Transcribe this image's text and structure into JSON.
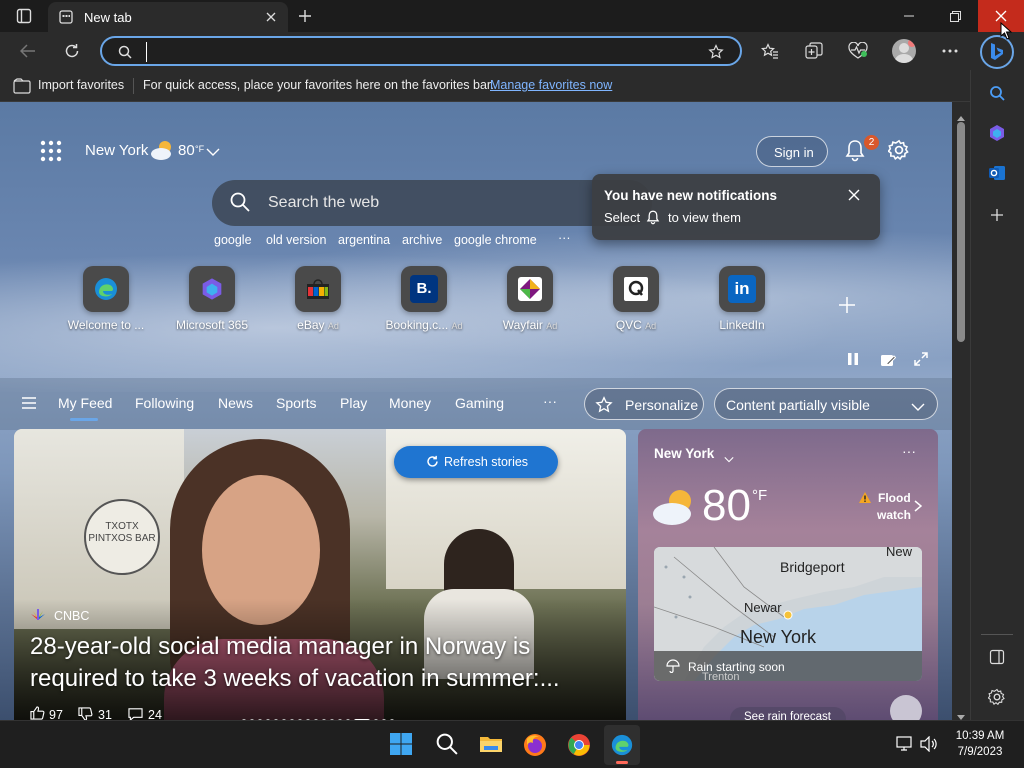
{
  "tab": {
    "title": "New tab"
  },
  "address": {
    "placeholder": ""
  },
  "favorites_bar": {
    "import_label": "Import favorites",
    "message": "For quick access, place your favorites here on the favorites bar.",
    "manage_link": "Manage favorites now"
  },
  "header": {
    "location": "New York",
    "temp": "80",
    "temp_unit": "°F",
    "sign_in": "Sign in",
    "notif_count": "2"
  },
  "search": {
    "placeholder": "Search the web",
    "suggestions": [
      "google",
      "old version",
      "argentina",
      "archive",
      "google chrome"
    ]
  },
  "notification_popup": {
    "title": "You have new notifications",
    "line_before": "Select",
    "line_after": "to view them"
  },
  "quick_links": [
    {
      "label": "Welcome to ...",
      "ad": "",
      "icon": "edge-icon"
    },
    {
      "label": "Microsoft 365",
      "ad": "",
      "icon": "m365-icon"
    },
    {
      "label": "eBay",
      "ad": "Ad",
      "icon": "ebay-icon"
    },
    {
      "label": "Booking.c...",
      "ad": "Ad",
      "icon": "booking-icon"
    },
    {
      "label": "Wayfair",
      "ad": "Ad",
      "icon": "wayfair-icon"
    },
    {
      "label": "QVC",
      "ad": "Ad",
      "icon": "qvc-icon"
    },
    {
      "label": "LinkedIn",
      "ad": "",
      "icon": "linkedin-icon"
    }
  ],
  "feed_nav": {
    "items": [
      "My Feed",
      "Following",
      "News",
      "Sports",
      "Play",
      "Money",
      "Gaming"
    ],
    "more": "···",
    "personalize": "Personalize",
    "visibility": "Content partially visible"
  },
  "story": {
    "refresh": "Refresh stories",
    "source": "CNBC",
    "headline": "28-year-old social media manager in Norway is required to take 3 weeks of vacation in summer:...",
    "likes": "97",
    "dislikes": "31",
    "comments": "24",
    "sign_text": "TXOTX PINTXOS BAR"
  },
  "weather_card": {
    "location": "New York",
    "temp": "80",
    "unit": "°F",
    "alert_line1": "Flood",
    "alert_line2": "watch",
    "map_labels": {
      "new": "New",
      "bridgeport": "Bridgeport",
      "newark": "Newar",
      "new_york": "New York",
      "trenton": "Trenton"
    },
    "rain": "Rain starting soon",
    "forecast_btn": "See rain forecast"
  },
  "clock": {
    "time": "10:39 AM",
    "date": "7/9/2023"
  },
  "colors": {
    "accent": "#0078d4",
    "link": "#7fb5ff",
    "alert": "#f5a623"
  }
}
